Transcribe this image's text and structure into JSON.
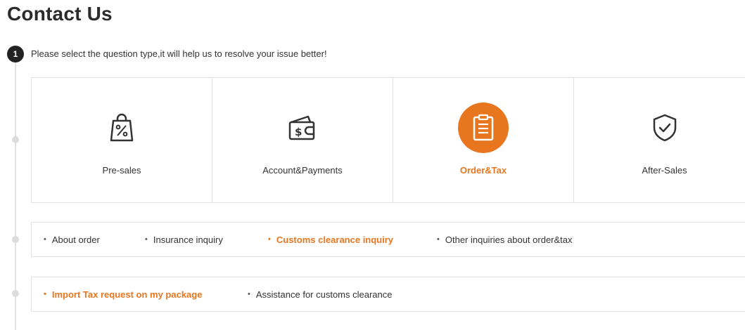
{
  "page": {
    "title": "Contact Us"
  },
  "step": {
    "number": "1",
    "instruction": "Please select the question type,it will help us to resolve your issue better!"
  },
  "question_types": [
    {
      "label": "Pre-sales",
      "icon": "shopping-bag-percent-icon",
      "active": false
    },
    {
      "label": "Account&Payments",
      "icon": "wallet-dollar-icon",
      "active": false
    },
    {
      "label": "Order&Tax",
      "icon": "clipboard-icon",
      "active": true
    },
    {
      "label": "After-Sales",
      "icon": "shield-check-icon",
      "active": false
    }
  ],
  "order_tax_options": [
    {
      "label": "About order",
      "active": false
    },
    {
      "label": "Insurance inquiry",
      "active": false
    },
    {
      "label": "Customs clearance inquiry",
      "active": true
    },
    {
      "label": "Other inquiries about order&tax",
      "active": false
    }
  ],
  "customs_options": [
    {
      "label": "Import Tax request on my package",
      "active": true
    },
    {
      "label": "Assistance for customs clearance",
      "active": false
    }
  ],
  "colors": {
    "accent": "#e8761f",
    "text": "#333333",
    "border": "#e2e2e2"
  }
}
